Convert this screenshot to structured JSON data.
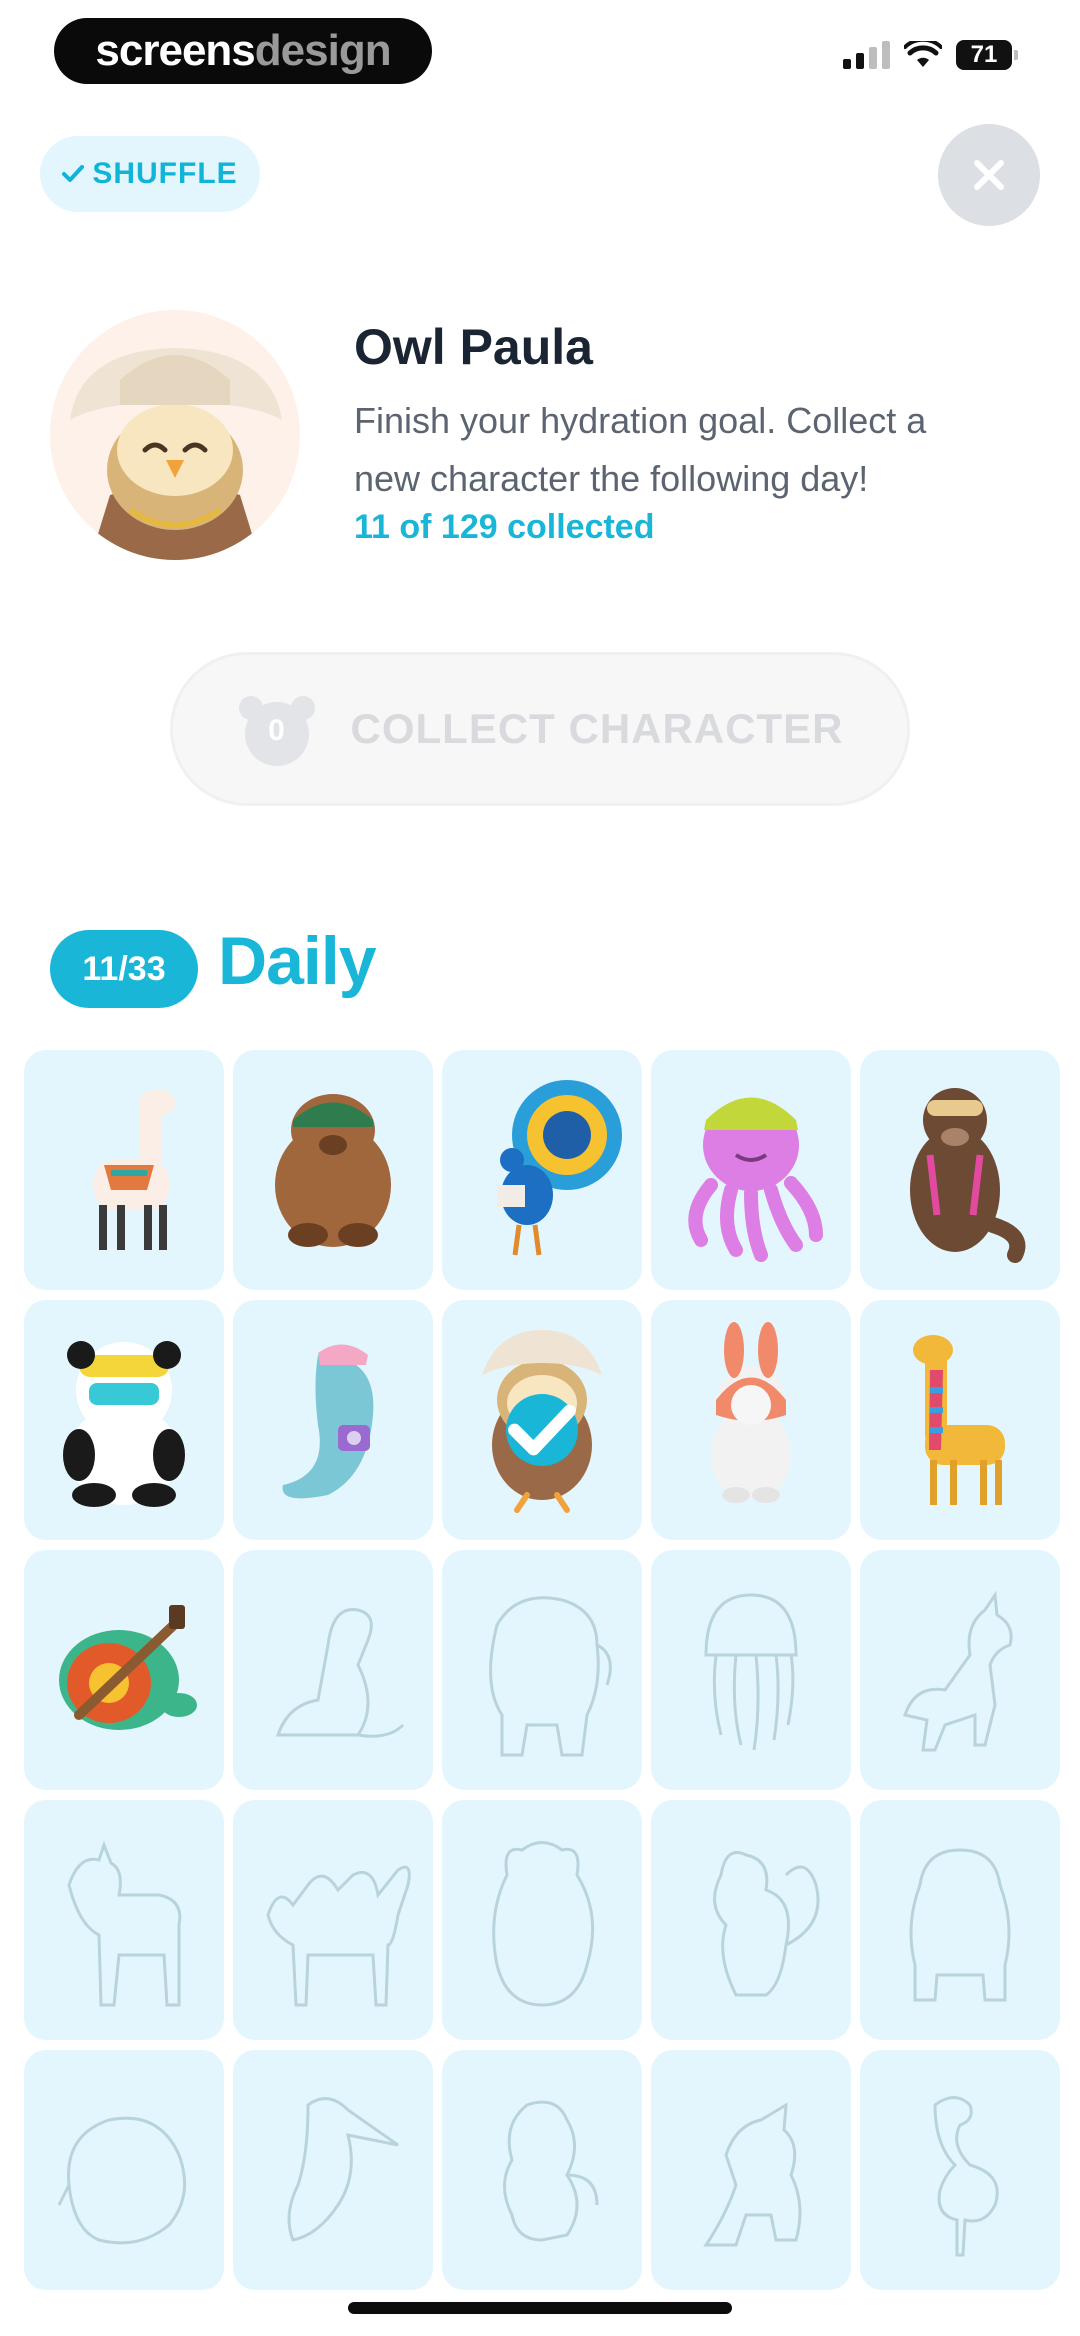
{
  "status_bar": {
    "brand_a": "screens",
    "brand_b": "design",
    "battery": "71"
  },
  "shuffle": {
    "label": "SHUFFLE"
  },
  "character": {
    "name": "Owl Paula",
    "description": "Finish your hydration goal. Collect a new character the following day!",
    "collected": "11 of 129 collected"
  },
  "collect_button": {
    "label": "COLLECT CHARACTER",
    "badge": "0"
  },
  "section": {
    "count": "11/33",
    "title": "Daily"
  },
  "colors": {
    "accent": "#19b6d8",
    "cell_bg": "#e4f6fd",
    "silhouette": "#b9d3dd"
  },
  "grid": [
    {
      "name": "llama-sticker",
      "icon": "llama-icon",
      "collected": true
    },
    {
      "name": "bear-sticker",
      "icon": "bear-icon",
      "collected": true
    },
    {
      "name": "peacock-sticker",
      "icon": "peacock-icon",
      "collected": true
    },
    {
      "name": "octopus-sticker",
      "icon": "octopus-icon",
      "collected": true
    },
    {
      "name": "otter-sticker",
      "icon": "otter-icon",
      "collected": true
    },
    {
      "name": "panda-sticker",
      "icon": "panda-icon",
      "collected": true
    },
    {
      "name": "dolphin-sticker",
      "icon": "dolphin-icon",
      "collected": true
    },
    {
      "name": "owl-sticker",
      "icon": "owl-icon",
      "collected": true,
      "selected": true
    },
    {
      "name": "bunny-sticker",
      "icon": "bunny-icon",
      "collected": true
    },
    {
      "name": "giraffe-sticker",
      "icon": "giraffe-icon",
      "collected": true
    },
    {
      "name": "turtle-sticker",
      "icon": "turtle-icon",
      "collected": true
    },
    {
      "name": "dinosaur-silhouette",
      "icon": "dinosaur-icon",
      "collected": false
    },
    {
      "name": "elephant-silhouette",
      "icon": "elephant-icon",
      "collected": false
    },
    {
      "name": "jellyfish-silhouette",
      "icon": "jellyfish-icon",
      "collected": false
    },
    {
      "name": "unicorn-silhouette",
      "icon": "unicorn-icon",
      "collected": false
    },
    {
      "name": "goat-silhouette",
      "icon": "goat-icon",
      "collected": false
    },
    {
      "name": "camel-silhouette",
      "icon": "camel-icon",
      "collected": false
    },
    {
      "name": "hamster-silhouette",
      "icon": "hamster-icon",
      "collected": false
    },
    {
      "name": "squirrel-silhouette",
      "icon": "squirrel-icon",
      "collected": false
    },
    {
      "name": "bulldog-silhouette",
      "icon": "bulldog-icon",
      "collected": false
    },
    {
      "name": "hedgehog-silhouette",
      "icon": "hedgehog-icon",
      "collected": false
    },
    {
      "name": "pelican-silhouette",
      "icon": "pelican-icon",
      "collected": false
    },
    {
      "name": "monkey-silhouette",
      "icon": "monkey-icon",
      "collected": false
    },
    {
      "name": "dragon-silhouette",
      "icon": "dragon-icon",
      "collected": false
    },
    {
      "name": "flamingo-silhouette",
      "icon": "flamingo-icon",
      "collected": false
    }
  ]
}
